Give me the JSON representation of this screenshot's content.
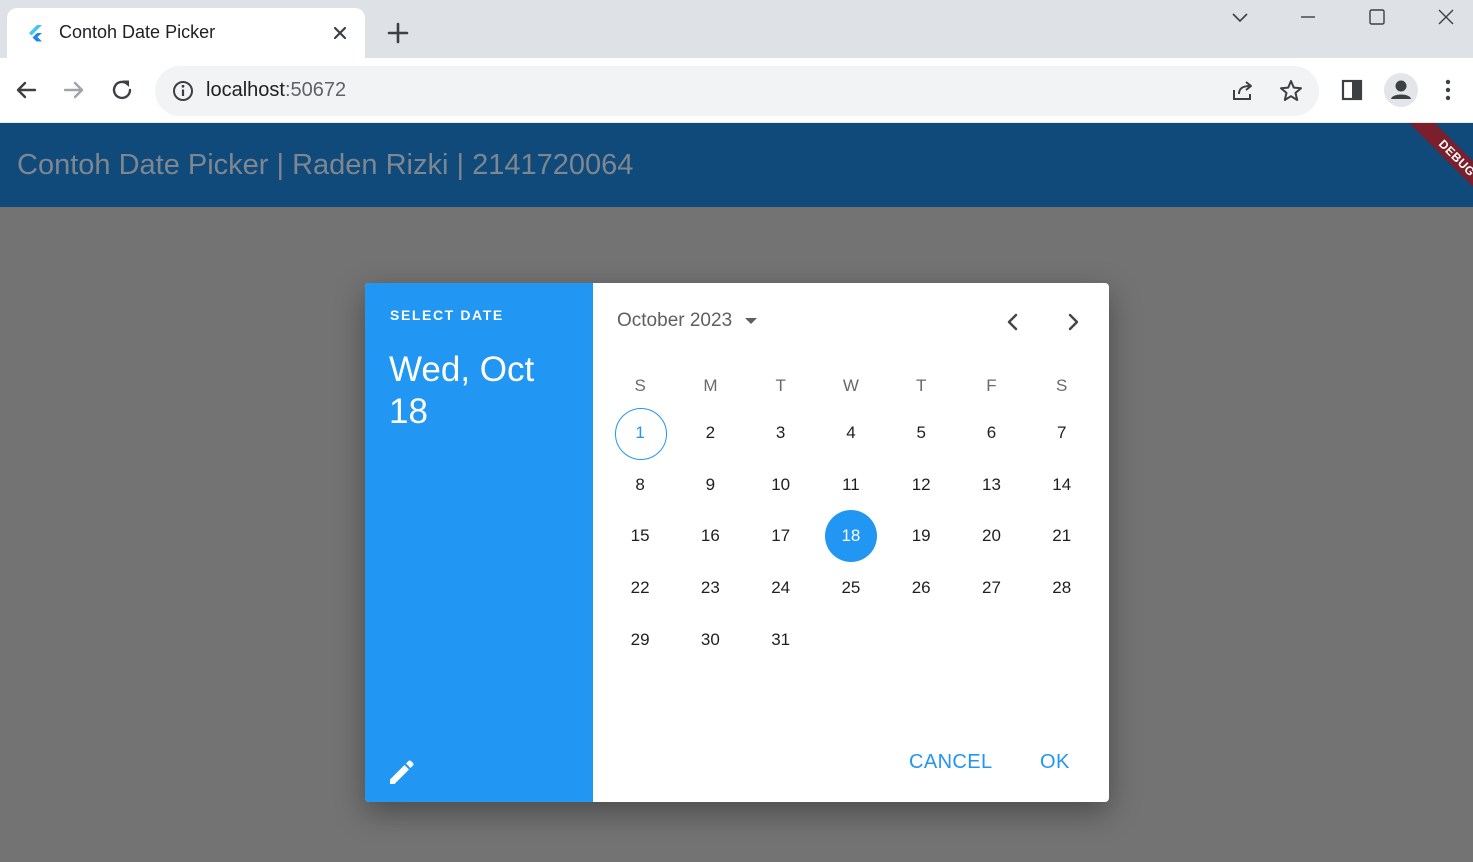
{
  "browser": {
    "tab": {
      "title": "Contoh Date Picker"
    },
    "address": {
      "host": "localhost",
      "port": ":50672"
    }
  },
  "app": {
    "title": "Contoh Date Picker | Raden Rizki | 2141720064",
    "debug_label": "DEBUG"
  },
  "dialog": {
    "help_text": "SELECT DATE",
    "selected_date_label": "Wed, Oct 18",
    "month_year": "October 2023",
    "weekdays": [
      "S",
      "M",
      "T",
      "W",
      "T",
      "F",
      "S"
    ],
    "days": [
      "1",
      "2",
      "3",
      "4",
      "5",
      "6",
      "7",
      "8",
      "9",
      "10",
      "11",
      "12",
      "13",
      "14",
      "15",
      "16",
      "17",
      "18",
      "19",
      "20",
      "21",
      "22",
      "23",
      "24",
      "25",
      "26",
      "27",
      "28",
      "29",
      "30",
      "31"
    ],
    "first_weekday_offset": 0,
    "today": "1",
    "selected_day": "18",
    "cancel_label": "CANCEL",
    "ok_label": "OK"
  },
  "colors": {
    "primary": "#2196f3",
    "appbar": "#0f4a7a",
    "scrim": "#737373",
    "debug_ribbon": "#7a1f2b"
  },
  "icons": {
    "tab_favicon": "flutter-icon",
    "tab_close": "close-icon",
    "new_tab": "plus-icon",
    "back": "arrow-left-icon",
    "forward": "arrow-right-icon",
    "reload": "reload-icon",
    "site_info": "info-icon",
    "share": "share-icon",
    "bookmark": "star-icon",
    "side_panel": "side-panel-icon",
    "profile": "profile-icon",
    "menu": "kebab-menu-icon",
    "edit": "pencil-icon",
    "month_dropdown": "caret-down-icon",
    "prev_month": "chevron-left-icon",
    "next_month": "chevron-right-icon"
  }
}
